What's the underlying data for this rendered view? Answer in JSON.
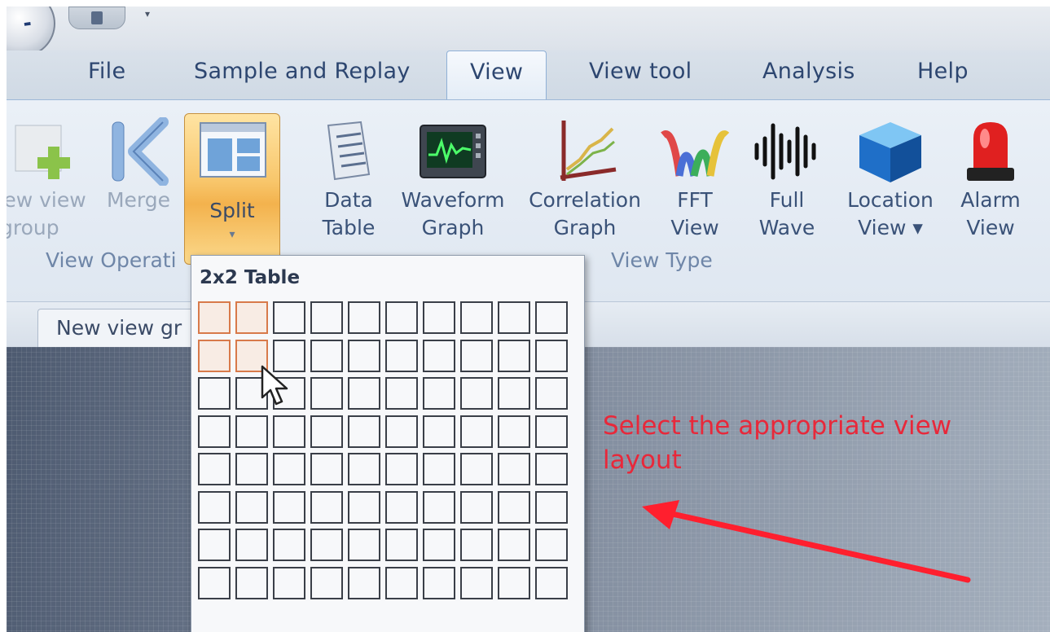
{
  "tabs": [
    {
      "label": "File",
      "active": false
    },
    {
      "label": "Sample and Replay",
      "active": false
    },
    {
      "label": "View",
      "active": true
    },
    {
      "label": "View tool",
      "active": false
    },
    {
      "label": "Analysis",
      "active": false
    },
    {
      "label": "Help",
      "active": false
    }
  ],
  "ribbon": {
    "new_view_group_line1": "ew view",
    "new_view_group_line2": "group",
    "merge": "Merge",
    "split": "Split",
    "data_table_line1": "Data",
    "data_table_line2": "Table",
    "waveform_line1": "Waveform",
    "waveform_line2": "Graph",
    "correlation_line1": "Correlation",
    "correlation_line2": "Graph",
    "fft_line1": "FFT",
    "fft_line2": "View",
    "fullwave_line1": "Full",
    "fullwave_line2": "Wave",
    "location_line1": "Location",
    "location_line2": "View ▾",
    "alarm_line1": "Alarm",
    "alarm_line2": "View",
    "group_view_operation": "View Operati",
    "group_view_type": "View Type"
  },
  "doc_tab": "New view gr",
  "dropdown": {
    "title": "2x2 Table",
    "columns": 10,
    "rows": 8,
    "selected_columns": 2,
    "selected_rows": 2
  },
  "annotation": "Select the appropriate view layout",
  "colors": {
    "annotation": "#e8283a",
    "split_highlight": "#f8c66b",
    "selected_cell": "#d87a4a"
  }
}
